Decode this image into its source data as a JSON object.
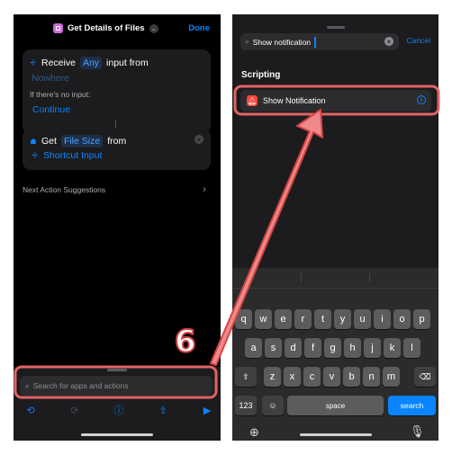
{
  "left": {
    "header": {
      "title": "Get Details of Files",
      "done": "Done"
    },
    "receive_card": {
      "receive": "Receive",
      "any": "Any",
      "input_from": "input from",
      "nowhere": "Nowhere",
      "if_no_input": "If there's no input:",
      "continue": "Continue"
    },
    "get_card": {
      "get": "Get",
      "file_size": "File Size",
      "from": "from",
      "shortcut_input": "Shortcut Input"
    },
    "suggestions": "Next Action Suggestions",
    "step_number": "6",
    "search_placeholder": "Search for apps and actions"
  },
  "right": {
    "search_value": "Show notification",
    "cancel": "Cancel",
    "section": "Scripting",
    "result": "Show Notification",
    "keyboard": {
      "row1": [
        "q",
        "w",
        "e",
        "r",
        "t",
        "y",
        "u",
        "i",
        "o",
        "p"
      ],
      "row2": [
        "a",
        "s",
        "d",
        "f",
        "g",
        "h",
        "j",
        "k",
        "l"
      ],
      "row3": [
        "z",
        "x",
        "c",
        "v",
        "b",
        "n",
        "m"
      ],
      "num_key": "123",
      "space": "space",
      "search": "search"
    }
  },
  "colors": {
    "accent": "#0a84ff",
    "highlight": "#e06464"
  }
}
